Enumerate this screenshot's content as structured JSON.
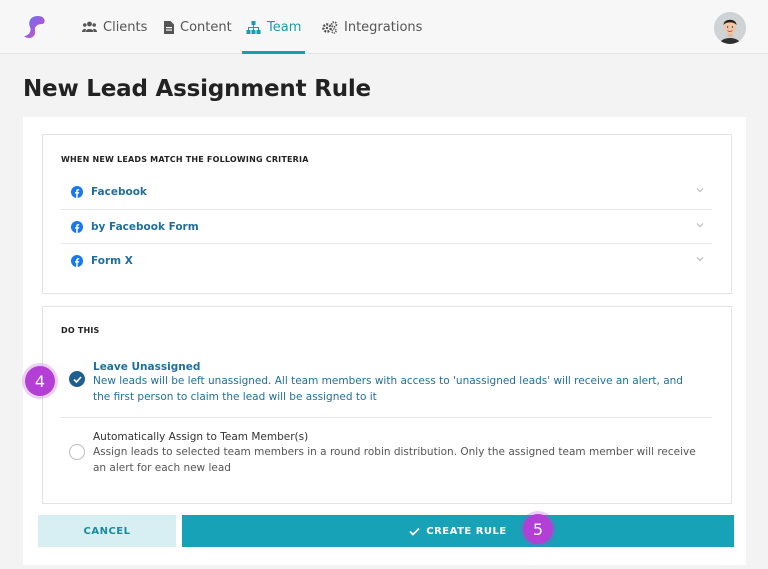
{
  "nav": {
    "items": [
      {
        "label": "Clients",
        "icon": "users-icon"
      },
      {
        "label": "Content",
        "icon": "document-icon"
      },
      {
        "label": "Team",
        "icon": "sitemap-icon",
        "active": true
      },
      {
        "label": "Integrations",
        "icon": "gears-icon"
      }
    ],
    "accent_color": "#1a9cb0"
  },
  "page": {
    "title": "New Lead Assignment Rule"
  },
  "criteria": {
    "heading": "WHEN NEW LEADS MATCH THE FOLLOWING CRITERIA",
    "rows": [
      {
        "label": "Facebook",
        "icon": "facebook-icon"
      },
      {
        "label": "by Facebook Form",
        "icon": "facebook-icon"
      },
      {
        "label": "Form X",
        "icon": "facebook-icon"
      }
    ]
  },
  "action": {
    "heading": "DO THIS",
    "options": [
      {
        "title": "Leave Unassigned",
        "description": "New leads will be left unassigned. All team members with access to 'unassigned leads' will receive an alert, and the first person to claim the lead will be assigned to it",
        "selected": true
      },
      {
        "title": "Automatically Assign to Team Member(s)",
        "description": "Assign leads to selected team members in a round robin distribution. Only the assigned team member will receive an alert for each new lead",
        "selected": false
      }
    ]
  },
  "buttons": {
    "cancel": "CANCEL",
    "create": "CREATE RULE"
  },
  "badges": {
    "step_a": "4",
    "step_b": "5"
  },
  "colors": {
    "primary": "#17a2b8",
    "link": "#1f6f9c",
    "badge": "#b33fd6"
  }
}
